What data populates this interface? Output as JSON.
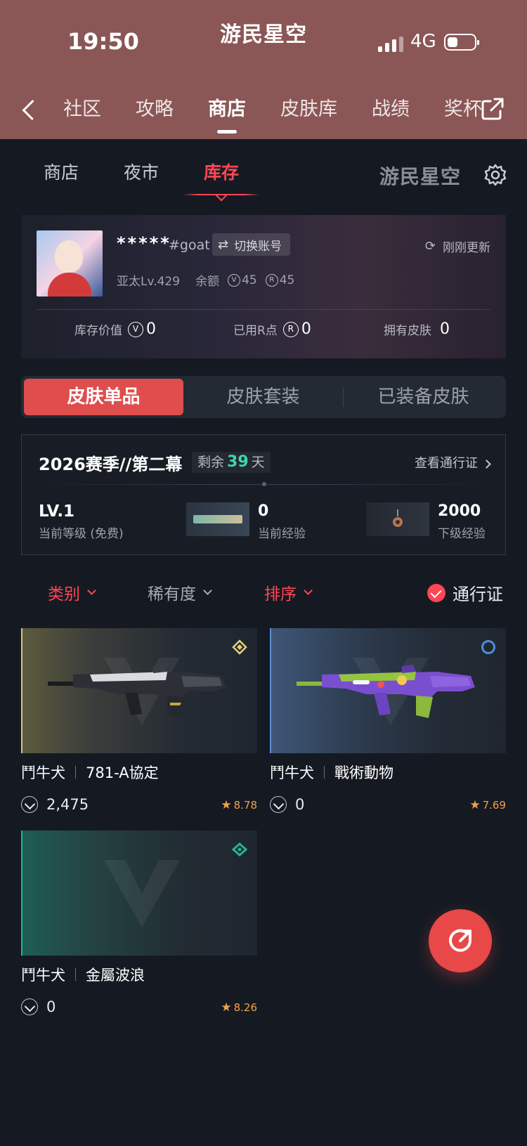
{
  "status_bar": {
    "time": "19:50",
    "network": "4G"
  },
  "app": {
    "logo": "游民星空"
  },
  "top_nav": {
    "items": [
      {
        "label": "社区",
        "active": false
      },
      {
        "label": "攻略",
        "active": false
      },
      {
        "label": "商店",
        "active": true
      },
      {
        "label": "皮肤库",
        "active": false
      },
      {
        "label": "战绩",
        "active": false
      },
      {
        "label": "奖杯",
        "active": false
      }
    ]
  },
  "sub_tabs": {
    "items": [
      {
        "label": "商店"
      },
      {
        "label": "夜市"
      },
      {
        "label": "库存"
      }
    ],
    "brand": "游民星空"
  },
  "profile": {
    "name": "*****",
    "tag": "#goat",
    "switch_label": "切换账号",
    "refresh_label": "刚刚更新",
    "region_level": "亚太Lv.429",
    "balance_label": "余额",
    "vp_balance": "45",
    "rp_balance": "45",
    "stats": {
      "inventory_value_label": "库存价值",
      "inventory_value": "0",
      "rp_used_label": "已用R点",
      "rp_used": "0",
      "skins_owned_label": "拥有皮肤",
      "skins_owned": "0"
    }
  },
  "segments": {
    "items": [
      {
        "label": "皮肤单品"
      },
      {
        "label": "皮肤套装"
      },
      {
        "label": "已装备皮肤"
      }
    ]
  },
  "battle_pass": {
    "season": "2026赛季//第二幕",
    "remain_label": "剩余",
    "remain_days": "39",
    "days_unit": "天",
    "view_label": "查看通行证",
    "level": "LV.1",
    "level_sub": "当前等级 (免费)",
    "current_xp": "0",
    "current_xp_label": "当前经验",
    "next_xp": "2000",
    "next_xp_label": "下级经验"
  },
  "filters": {
    "category": "类别",
    "rarity": "稀有度",
    "sort": "排序",
    "pass": "通行证"
  },
  "skins": [
    {
      "weapon": "鬥牛犬",
      "name": "781-A協定",
      "price": "2,475",
      "score": "8.78",
      "rarity_color": "#e6d27a"
    },
    {
      "weapon": "鬥牛犬",
      "name": "戰術動物",
      "price": "0",
      "score": "7.69",
      "rarity_color": "#4a90d9"
    },
    {
      "weapon": "鬥牛犬",
      "name": "金屬波浪",
      "price": "0",
      "score": "8.26",
      "rarity_color": "#1fb59a"
    }
  ],
  "colors": {
    "header": "#8b5656",
    "accent": "#ff4655",
    "background": "#151a22",
    "days_highlight": "#3dd8a8",
    "score": "#f1a14b"
  }
}
